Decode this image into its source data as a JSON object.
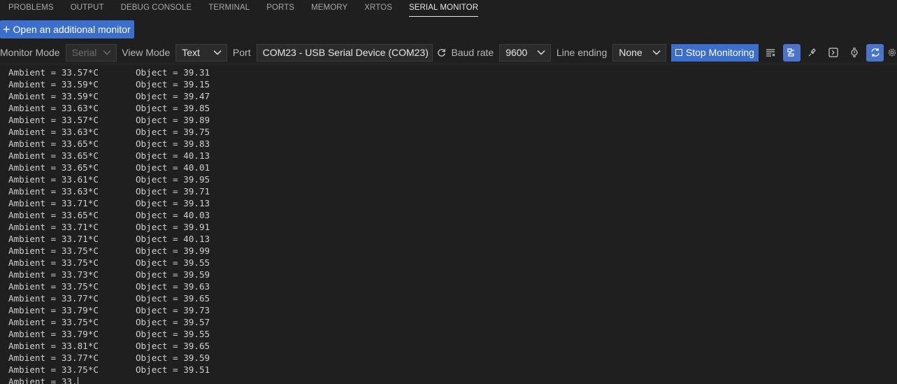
{
  "tabs": [
    {
      "label": "PROBLEMS"
    },
    {
      "label": "OUTPUT"
    },
    {
      "label": "DEBUG CONSOLE"
    },
    {
      "label": "TERMINAL"
    },
    {
      "label": "PORTS"
    },
    {
      "label": "MEMORY"
    },
    {
      "label": "XRTOS"
    },
    {
      "label": "SERIAL MONITOR"
    }
  ],
  "active_tab": "SERIAL MONITOR",
  "open_monitor_label": "Open an additional monitor",
  "toolbar": {
    "monitor_mode_label": "Monitor Mode",
    "monitor_mode_value": "Serial",
    "view_mode_label": "View Mode",
    "view_mode_value": "Text",
    "port_label": "Port",
    "port_value": "COM23 - USB Serial Device (COM23)",
    "baud_label": "Baud rate",
    "baud_value": "9600",
    "line_ending_label": "Line ending",
    "line_ending_value": "None",
    "stop_label": "Stop Monitoring"
  },
  "colors": {
    "accent": "#3c6ecb",
    "background": "#1f1f1f",
    "toggle_on": "#4b73c9"
  },
  "output_lines": [
    "Ambient = 33.57*C       Object = 39.31",
    "Ambient = 33.59*C       Object = 39.15",
    "Ambient = 33.59*C       Object = 39.47",
    "Ambient = 33.63*C       Object = 39.85",
    "Ambient = 33.57*C       Object = 39.89",
    "Ambient = 33.63*C       Object = 39.75",
    "Ambient = 33.65*C       Object = 39.83",
    "Ambient = 33.65*C       Object = 40.13",
    "Ambient = 33.65*C       Object = 40.01",
    "Ambient = 33.61*C       Object = 39.95",
    "Ambient = 33.63*C       Object = 39.71",
    "Ambient = 33.71*C       Object = 39.13",
    "Ambient = 33.65*C       Object = 40.03",
    "Ambient = 33.71*C       Object = 39.91",
    "Ambient = 33.71*C       Object = 40.13",
    "Ambient = 33.75*C       Object = 39.99",
    "Ambient = 33.75*C       Object = 39.55",
    "Ambient = 33.73*C       Object = 39.59",
    "Ambient = 33.75*C       Object = 39.63",
    "Ambient = 33.77*C       Object = 39.65",
    "Ambient = 33.79*C       Object = 39.73",
    "Ambient = 33.75*C       Object = 39.57",
    "Ambient = 33.79*C       Object = 39.55",
    "Ambient = 33.81*C       Object = 39.65",
    "Ambient = 33.77*C       Object = 39.59",
    "Ambient = 33.75*C       Object = 39.51"
  ],
  "partial_line": "Ambient = 33."
}
